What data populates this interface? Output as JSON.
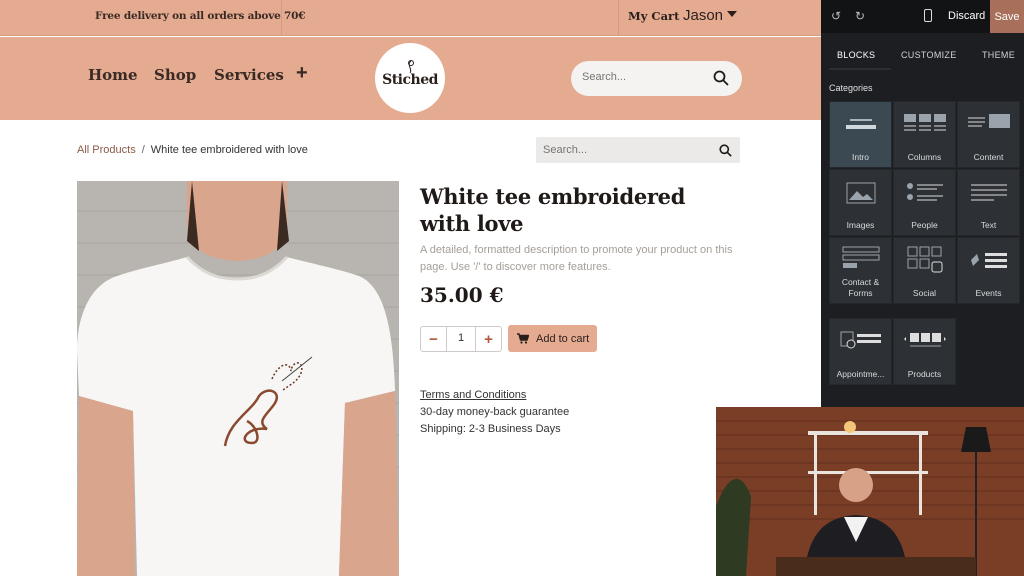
{
  "topbar": {
    "promo": "Free delivery on all orders above 70€",
    "my_cart": "My Cart",
    "user": "Jason"
  },
  "header": {
    "nav": [
      "Home",
      "Shop",
      "Services"
    ],
    "logo_text": "Stiched",
    "search_placeholder": "Search..."
  },
  "breadcrumb": {
    "all_products": "All Products",
    "separator": "/",
    "current": "White tee embroidered with love"
  },
  "product_search_placeholder": "Search...",
  "product": {
    "title": "White tee embroidered with love",
    "description": "A detailed, formatted description to promote your product on this page. Use '/' to discover more features.",
    "price": "35.00 €",
    "quantity": "1",
    "add_to_cart": "Add to cart",
    "terms": "Terms and Conditions",
    "guarantee": "30-day money-back guarantee",
    "shipping": "Shipping: 2-3 Business Days"
  },
  "editor": {
    "discard": "Discard",
    "save": "Save",
    "tabs": [
      "BLOCKS",
      "CUSTOMIZE",
      "THEME"
    ],
    "active_tab": "BLOCKS",
    "categories_title": "Categories",
    "blocks": [
      "Intro",
      "Columns",
      "Content",
      "Images",
      "People",
      "Text",
      "Contact & Forms",
      "Social",
      "Events",
      "Appointme...",
      "Products"
    ],
    "selected_block": "Intro"
  },
  "colors": {
    "brand": "#e4ab91",
    "editor_bg": "#1c1e21",
    "save_button": "#a8705a",
    "quantity_accent": "#b35a3e"
  }
}
